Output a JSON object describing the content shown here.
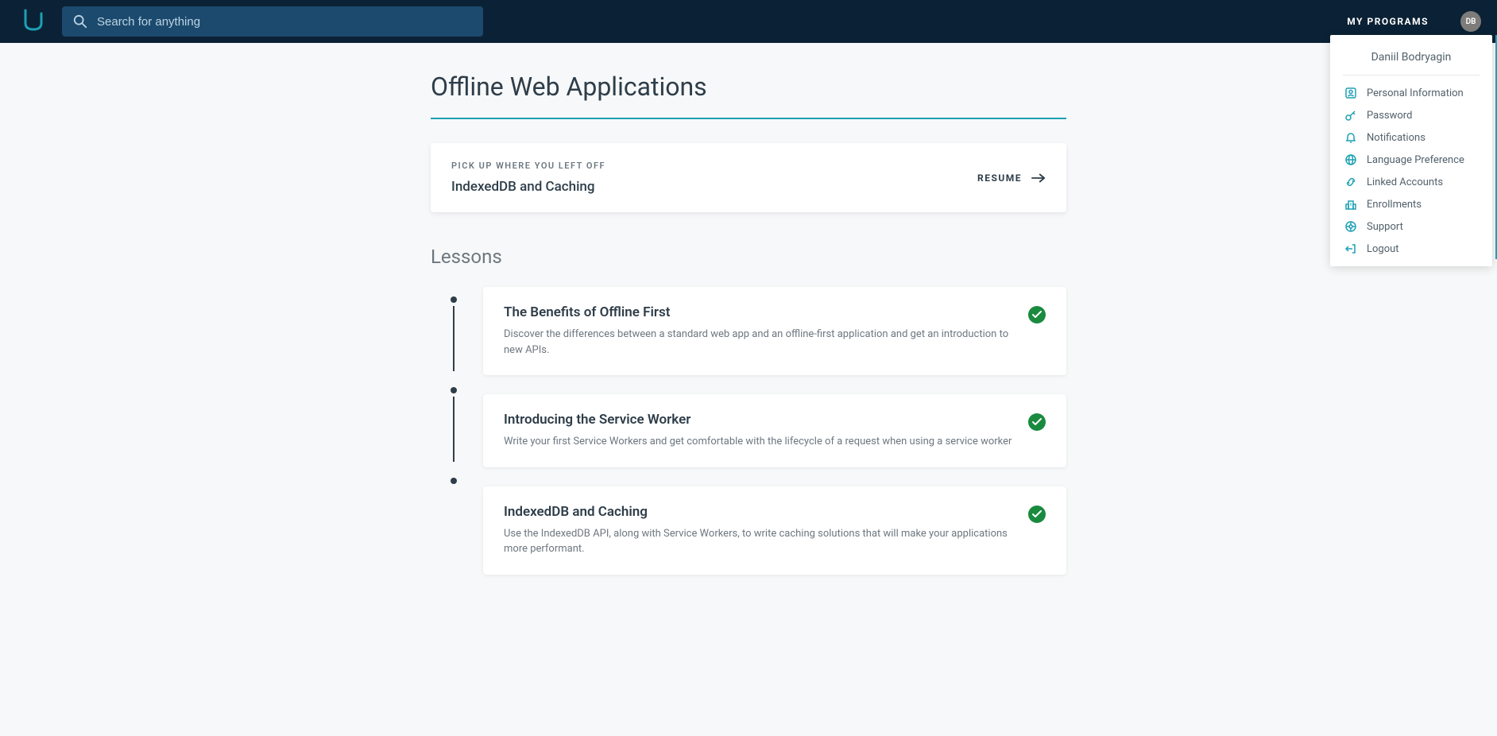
{
  "header": {
    "search_placeholder": "Search for anything",
    "my_programs_label": "MY PROGRAMS",
    "avatar_initials": "DB"
  },
  "page": {
    "title": "Offline Web Applications",
    "resume": {
      "label": "PICK UP WHERE YOU LEFT OFF",
      "lesson": "IndexedDB and Caching",
      "button": "RESUME"
    },
    "lessons_heading": "Lessons",
    "lessons": [
      {
        "title": "The Benefits of Offline First",
        "description": "Discover the differences between a standard web app and an offline-first application and get an introduction to new APIs.",
        "completed": true
      },
      {
        "title": "Introducing the Service Worker",
        "description": "Write your first Service Workers and get comfortable with the lifecycle of a request when using a service worker",
        "completed": true
      },
      {
        "title": "IndexedDB and Caching",
        "description": "Use the IndexedDB API, along with Service Workers, to write caching solutions that will make your applications more performant.",
        "completed": true
      }
    ]
  },
  "dropdown": {
    "user_name": "Daniil Bodryagin",
    "items": [
      {
        "icon": "person",
        "label": "Personal Information"
      },
      {
        "icon": "key",
        "label": "Password"
      },
      {
        "icon": "bell",
        "label": "Notifications"
      },
      {
        "icon": "globe",
        "label": "Language Preference"
      },
      {
        "icon": "link",
        "label": "Linked Accounts"
      },
      {
        "icon": "building",
        "label": "Enrollments"
      },
      {
        "icon": "support",
        "label": "Support"
      },
      {
        "icon": "logout",
        "label": "Logout"
      }
    ]
  },
  "colors": {
    "accent": "#1da0b4",
    "success": "#1a8a3f",
    "header_bg": "#0b2135"
  }
}
